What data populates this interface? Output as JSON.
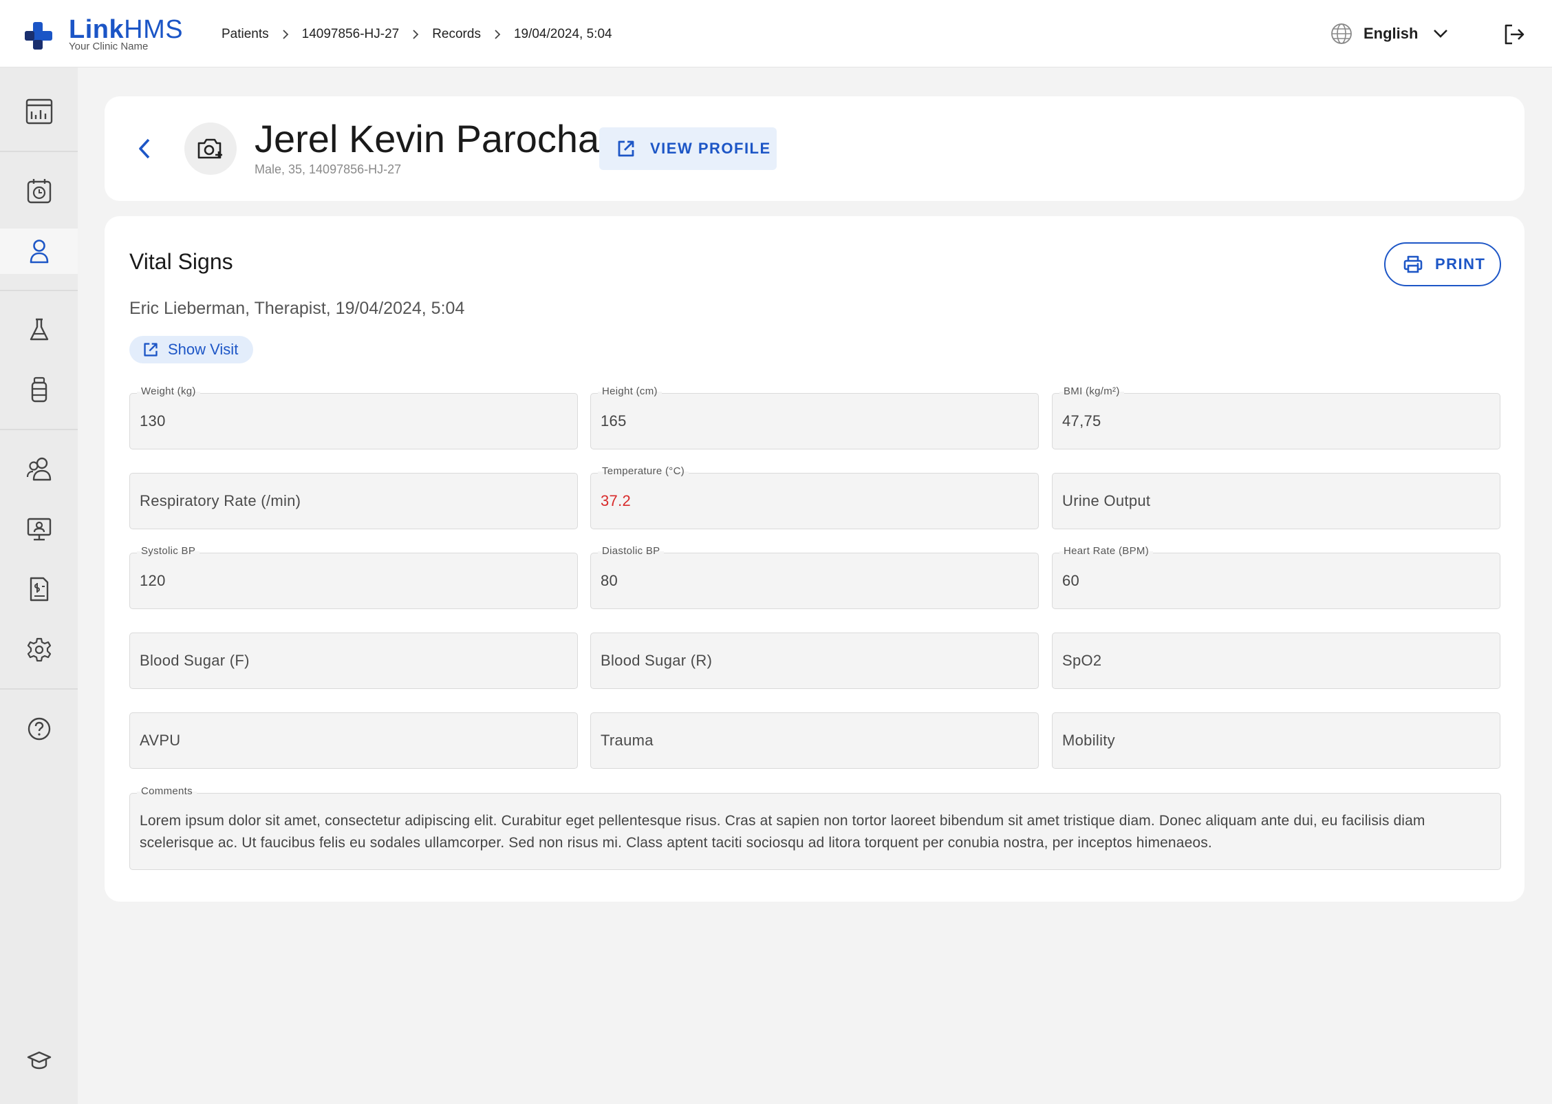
{
  "brand": {
    "name_bold": "Link",
    "name_regular": "HMS",
    "tagline": "Your Clinic Name",
    "accent_color": "#1b55c6"
  },
  "breadcrumb": [
    "Patients",
    "14097856-HJ-27",
    "Records",
    "19/04/2024, 5:04"
  ],
  "header": {
    "language": "English",
    "language_icon": "globe-icon",
    "logout_icon": "logout-icon"
  },
  "sidebar": {
    "items": [
      {
        "icon": "dashboard-icon",
        "active": false
      },
      {
        "icon": "appointments-icon",
        "active": false
      },
      {
        "icon": "patients-icon",
        "active": true
      },
      {
        "icon": "lab-icon",
        "active": false
      },
      {
        "icon": "pharmacy-icon",
        "active": false
      },
      {
        "icon": "staff-icon",
        "active": false
      },
      {
        "icon": "monitor-icon",
        "active": false
      },
      {
        "icon": "billing-icon",
        "active": false
      },
      {
        "icon": "settings-icon",
        "active": false
      },
      {
        "icon": "help-icon",
        "active": false
      },
      {
        "icon": "training-icon",
        "active": false
      }
    ]
  },
  "patient": {
    "name": "Jerel Kevin Parocha",
    "meta": "Male, 35, 14097856-HJ-27",
    "view_profile_label": "VIEW PROFILE"
  },
  "vitals": {
    "title": "Vital Signs",
    "print_label": "PRINT",
    "author_line": "Eric Lieberman, Therapist, 19/04/2024, 5:04",
    "show_visit_label": "Show Visit",
    "fields": {
      "weight": {
        "label": "Weight (kg)",
        "value": "130"
      },
      "height": {
        "label": "Height (cm)",
        "value": "165"
      },
      "bmi": {
        "label": "BMI (kg/m²)",
        "value": "47,75"
      },
      "respiratory_rate": {
        "placeholder": "Respiratory Rate (/min)"
      },
      "temperature": {
        "label": "Temperature (°C)",
        "value": "37.2",
        "color": "#d82a2a"
      },
      "urine_output": {
        "placeholder": "Urine Output"
      },
      "systolic_bp": {
        "label": "Systolic BP",
        "value": "120"
      },
      "diastolic_bp": {
        "label": "Diastolic BP",
        "value": "80"
      },
      "heart_rate": {
        "label": "Heart Rate (BPM)",
        "value": "60"
      },
      "blood_sugar_f": {
        "placeholder": "Blood Sugar (F)"
      },
      "blood_sugar_r": {
        "placeholder": "Blood Sugar (R)"
      },
      "spo2": {
        "placeholder": "SpO2"
      },
      "avpu": {
        "placeholder": "AVPU"
      },
      "trauma": {
        "placeholder": "Trauma"
      },
      "mobility": {
        "placeholder": "Mobility"
      }
    },
    "comments": {
      "label": "Comments",
      "value": "Lorem ipsum dolor sit amet, consectetur adipiscing elit. Curabitur eget pellentesque risus. Cras at sapien non tortor laoreet bibendum sit amet tristique diam. Donec aliquam ante dui, eu facilisis diam scelerisque ac. Ut faucibus felis eu sodales ullamcorper. Sed non risus mi. Class aptent taciti sociosqu ad litora torquent per conubia nostra, per inceptos himenaeos."
    }
  }
}
